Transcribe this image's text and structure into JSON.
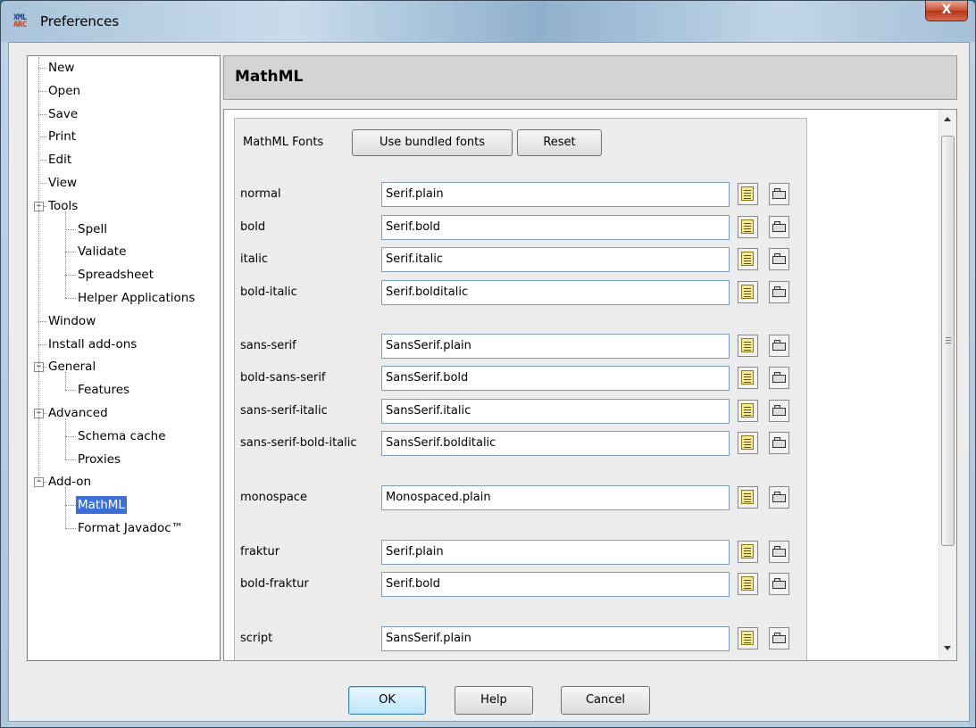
{
  "window": {
    "title": "Preferences",
    "close_label": "X",
    "app_icon_top": "XML",
    "app_icon_bottom": "ARC"
  },
  "tree": {
    "items": [
      {
        "label": "New",
        "level": 0,
        "toggle": ""
      },
      {
        "label": "Open",
        "level": 0,
        "toggle": ""
      },
      {
        "label": "Save",
        "level": 0,
        "toggle": ""
      },
      {
        "label": "Print",
        "level": 0,
        "toggle": ""
      },
      {
        "label": "Edit",
        "level": 0,
        "toggle": ""
      },
      {
        "label": "View",
        "level": 0,
        "toggle": ""
      },
      {
        "label": "Tools",
        "level": 0,
        "toggle": "−"
      },
      {
        "label": "Spell",
        "level": 1,
        "toggle": ""
      },
      {
        "label": "Validate",
        "level": 1,
        "toggle": ""
      },
      {
        "label": "Spreadsheet",
        "level": 1,
        "toggle": ""
      },
      {
        "label": "Helper Applications",
        "level": 1,
        "toggle": ""
      },
      {
        "label": "Window",
        "level": 0,
        "toggle": ""
      },
      {
        "label": "Install add-ons",
        "level": 0,
        "toggle": ""
      },
      {
        "label": "General",
        "level": 0,
        "toggle": "−"
      },
      {
        "label": "Features",
        "level": 1,
        "toggle": ""
      },
      {
        "label": "Advanced",
        "level": 0,
        "toggle": "−"
      },
      {
        "label": "Schema cache",
        "level": 1,
        "toggle": ""
      },
      {
        "label": "Proxies",
        "level": 1,
        "toggle": ""
      },
      {
        "label": "Add-on",
        "level": 0,
        "toggle": "−"
      },
      {
        "label": "MathML",
        "level": 1,
        "toggle": "",
        "selected": true
      },
      {
        "label": "Format Javadoc™",
        "level": 1,
        "toggle": ""
      }
    ]
  },
  "section": {
    "title": "MathML"
  },
  "fonts": {
    "label": "MathML Fonts",
    "use_bundled_label": "Use bundled fonts",
    "reset_label": "Reset",
    "rows": [
      {
        "label": "normal",
        "value": "Serif.plain"
      },
      {
        "label": "bold",
        "value": "Serif.bold"
      },
      {
        "label": "italic",
        "value": "Serif.italic"
      },
      {
        "label": "bold-italic",
        "value": "Serif.bolditalic"
      },
      {
        "label": "sans-serif",
        "value": "SansSerif.plain"
      },
      {
        "label": "bold-sans-serif",
        "value": "SansSerif.bold"
      },
      {
        "label": "sans-serif-italic",
        "value": "SansSerif.italic"
      },
      {
        "label": "sans-serif-bold-italic",
        "value": "SansSerif.bolditalic"
      },
      {
        "label": "monospace",
        "value": "Monospaced.plain"
      },
      {
        "label": "fraktur",
        "value": "Serif.plain"
      },
      {
        "label": "bold-fraktur",
        "value": "Serif.bold"
      },
      {
        "label": "script",
        "value": "SansSerif.plain"
      }
    ]
  },
  "buttons": {
    "ok": "OK",
    "help": "Help",
    "cancel": "Cancel"
  }
}
